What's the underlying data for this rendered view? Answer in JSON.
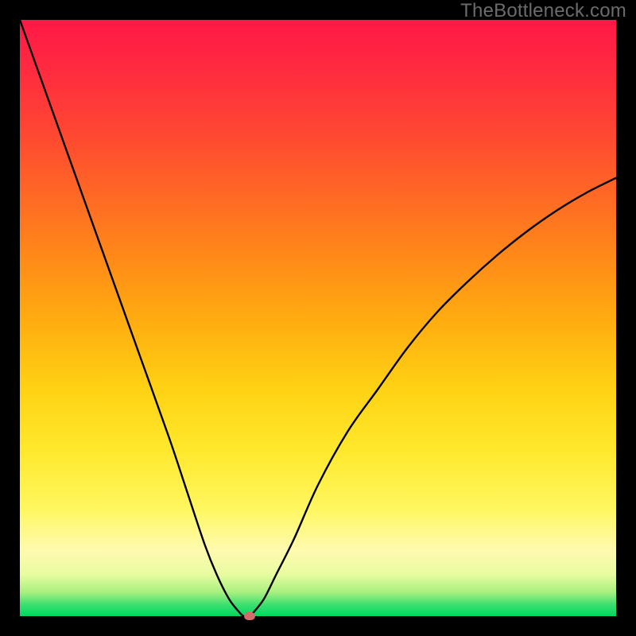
{
  "watermark": {
    "text": "TheBottleneck.com"
  },
  "colors": {
    "gradient_top": "#ff1846",
    "gradient_bottom": "#00d860",
    "curve": "#000000",
    "marker": "#d46a6a",
    "frame": "#000000"
  },
  "chart_data": {
    "type": "line",
    "title": "",
    "xlabel": "",
    "ylabel": "",
    "xlim": [
      0,
      1
    ],
    "ylim": [
      0,
      1
    ],
    "x": [
      0.0,
      0.05,
      0.1,
      0.15,
      0.2,
      0.25,
      0.28,
      0.31,
      0.33,
      0.35,
      0.365,
      0.375,
      0.385,
      0.395,
      0.41,
      0.43,
      0.46,
      0.5,
      0.55,
      0.6,
      0.65,
      0.7,
      0.75,
      0.8,
      0.85,
      0.9,
      0.95,
      1.0
    ],
    "y": [
      1.0,
      0.86,
      0.72,
      0.58,
      0.44,
      0.3,
      0.21,
      0.12,
      0.07,
      0.03,
      0.01,
      0.0,
      0.0,
      0.01,
      0.03,
      0.07,
      0.13,
      0.22,
      0.31,
      0.38,
      0.45,
      0.51,
      0.56,
      0.605,
      0.645,
      0.68,
      0.71,
      0.735
    ],
    "marker": {
      "x": 0.385,
      "y": 0.0
    },
    "legend": [],
    "annotations": []
  }
}
